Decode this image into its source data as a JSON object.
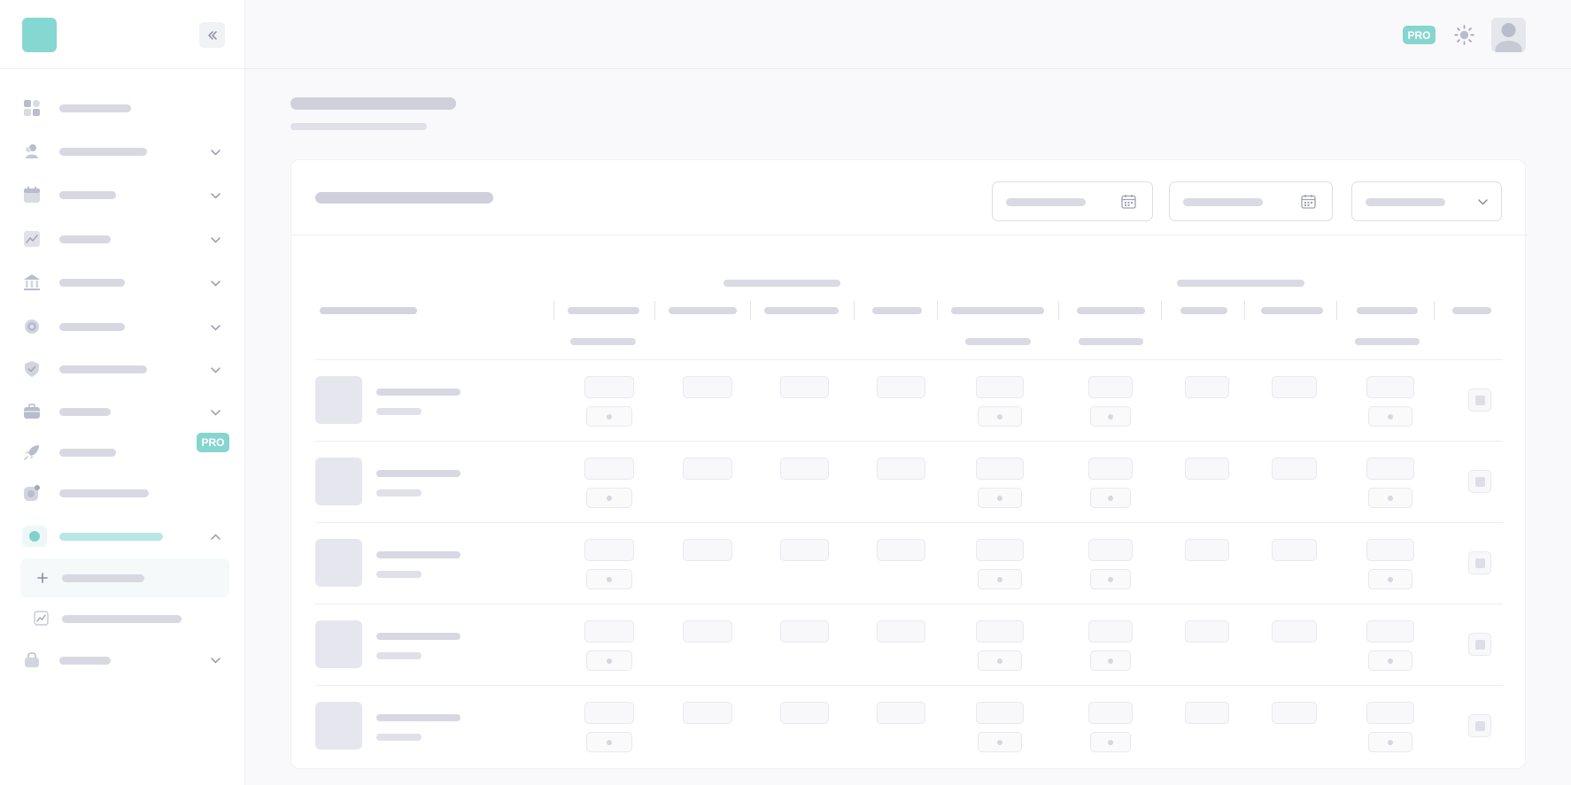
{
  "header": {
    "pro_badge": "PRO",
    "theme_icon": "sun-icon",
    "avatar_icon": "user-avatar-icon"
  },
  "sidebar": {
    "pro_badge": "PRO",
    "collapse_icon": "double-chevron-left-icon",
    "items": [
      {
        "icon": "dashboard-grid-icon",
        "has_chevron": false
      },
      {
        "icon": "users-icon",
        "has_chevron": true
      },
      {
        "icon": "calendar-icon",
        "has_chevron": true
      },
      {
        "icon": "chart-line-icon",
        "has_chevron": true
      },
      {
        "icon": "bank-icon",
        "has_chevron": true
      },
      {
        "icon": "gear-icon",
        "has_chevron": true
      },
      {
        "icon": "shield-check-icon",
        "has_chevron": true
      },
      {
        "icon": "briefcase-icon",
        "has_chevron": true
      },
      {
        "icon": "rocket-icon",
        "has_chevron": false,
        "badge": "PRO"
      },
      {
        "icon": "pie-chart-icon",
        "has_chevron": false
      },
      {
        "icon": "active-dot-icon",
        "has_chevron": true,
        "expanded": true
      },
      {
        "icon": "plus-icon",
        "sub": true,
        "active": true
      },
      {
        "icon": "chart-line-icon",
        "sub": true
      },
      {
        "icon": "lock-icon",
        "has_chevron": true
      }
    ]
  },
  "colors": {
    "accent": "#86d5cf",
    "logo": "#85d8d1",
    "skeleton": "#d7d8e2",
    "background": "#f9f9fb"
  },
  "table": {
    "row_count": 5,
    "filters": [
      {
        "icon": "calendar-icon"
      },
      {
        "icon": "calendar-icon"
      },
      {
        "icon": "chevron-down-icon"
      }
    ]
  }
}
